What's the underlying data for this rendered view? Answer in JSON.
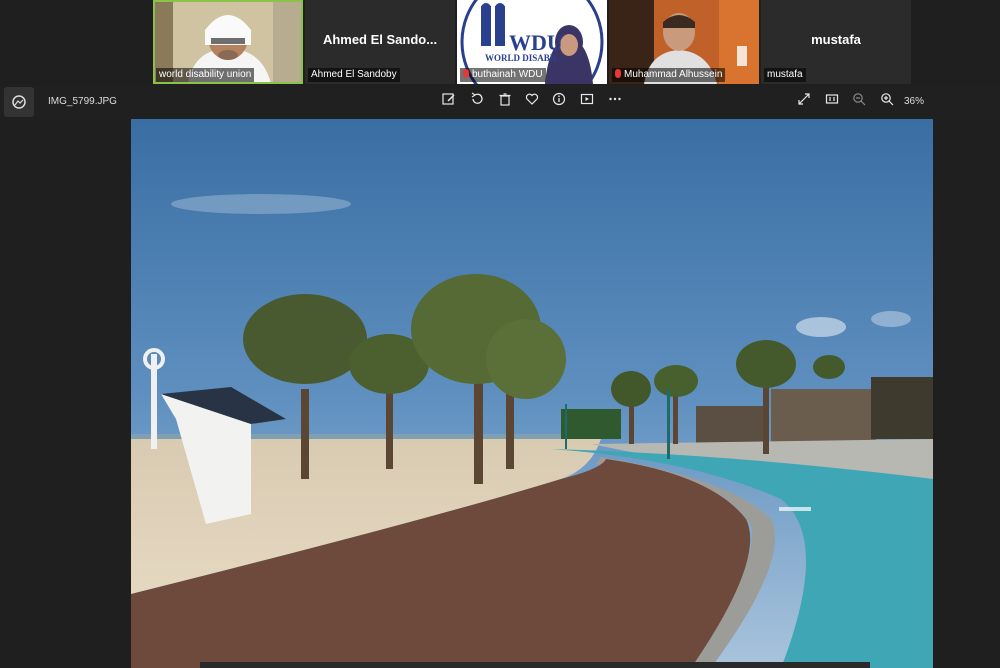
{
  "participants": [
    {
      "label": "world disability union"
    },
    {
      "label": "Ahmed El Sandoby",
      "display_name": "Ahmed  El  Sando..."
    },
    {
      "label": "buthainah WDU",
      "logo_text": "WDU",
      "logo_sub": "WORLD DISABIL"
    },
    {
      "label": "Muhammad Alhussein"
    },
    {
      "label": "mustafa",
      "display_name": "mustafa"
    }
  ],
  "viewer": {
    "filename": "IMG_5799.JPG",
    "zoom": "36%"
  },
  "photo": {
    "path_marking": "ـــ"
  }
}
